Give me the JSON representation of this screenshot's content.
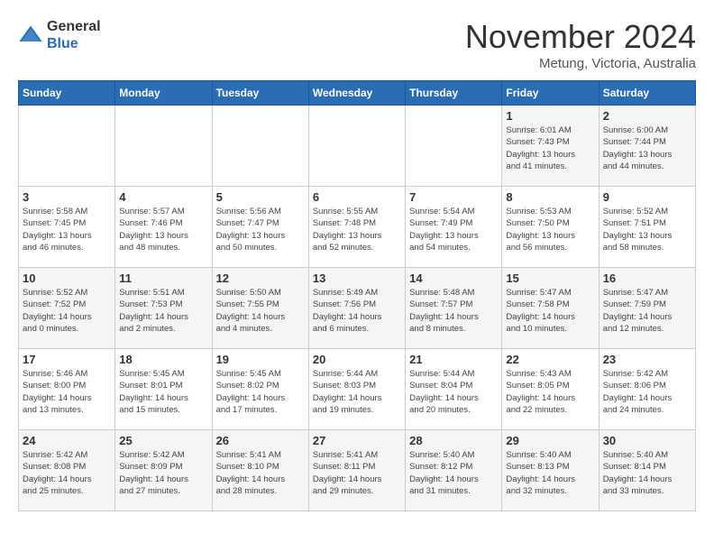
{
  "logo": {
    "general": "General",
    "blue": "Blue"
  },
  "title": "November 2024",
  "location": "Metung, Victoria, Australia",
  "days_of_week": [
    "Sunday",
    "Monday",
    "Tuesday",
    "Wednesday",
    "Thursday",
    "Friday",
    "Saturday"
  ],
  "weeks": [
    [
      {
        "day": "",
        "info": ""
      },
      {
        "day": "",
        "info": ""
      },
      {
        "day": "",
        "info": ""
      },
      {
        "day": "",
        "info": ""
      },
      {
        "day": "",
        "info": ""
      },
      {
        "day": "1",
        "info": "Sunrise: 6:01 AM\nSunset: 7:43 PM\nDaylight: 13 hours\nand 41 minutes."
      },
      {
        "day": "2",
        "info": "Sunrise: 6:00 AM\nSunset: 7:44 PM\nDaylight: 13 hours\nand 44 minutes."
      }
    ],
    [
      {
        "day": "3",
        "info": "Sunrise: 5:58 AM\nSunset: 7:45 PM\nDaylight: 13 hours\nand 46 minutes."
      },
      {
        "day": "4",
        "info": "Sunrise: 5:57 AM\nSunset: 7:46 PM\nDaylight: 13 hours\nand 48 minutes."
      },
      {
        "day": "5",
        "info": "Sunrise: 5:56 AM\nSunset: 7:47 PM\nDaylight: 13 hours\nand 50 minutes."
      },
      {
        "day": "6",
        "info": "Sunrise: 5:55 AM\nSunset: 7:48 PM\nDaylight: 13 hours\nand 52 minutes."
      },
      {
        "day": "7",
        "info": "Sunrise: 5:54 AM\nSunset: 7:49 PM\nDaylight: 13 hours\nand 54 minutes."
      },
      {
        "day": "8",
        "info": "Sunrise: 5:53 AM\nSunset: 7:50 PM\nDaylight: 13 hours\nand 56 minutes."
      },
      {
        "day": "9",
        "info": "Sunrise: 5:52 AM\nSunset: 7:51 PM\nDaylight: 13 hours\nand 58 minutes."
      }
    ],
    [
      {
        "day": "10",
        "info": "Sunrise: 5:52 AM\nSunset: 7:52 PM\nDaylight: 14 hours\nand 0 minutes."
      },
      {
        "day": "11",
        "info": "Sunrise: 5:51 AM\nSunset: 7:53 PM\nDaylight: 14 hours\nand 2 minutes."
      },
      {
        "day": "12",
        "info": "Sunrise: 5:50 AM\nSunset: 7:55 PM\nDaylight: 14 hours\nand 4 minutes."
      },
      {
        "day": "13",
        "info": "Sunrise: 5:49 AM\nSunset: 7:56 PM\nDaylight: 14 hours\nand 6 minutes."
      },
      {
        "day": "14",
        "info": "Sunrise: 5:48 AM\nSunset: 7:57 PM\nDaylight: 14 hours\nand 8 minutes."
      },
      {
        "day": "15",
        "info": "Sunrise: 5:47 AM\nSunset: 7:58 PM\nDaylight: 14 hours\nand 10 minutes."
      },
      {
        "day": "16",
        "info": "Sunrise: 5:47 AM\nSunset: 7:59 PM\nDaylight: 14 hours\nand 12 minutes."
      }
    ],
    [
      {
        "day": "17",
        "info": "Sunrise: 5:46 AM\nSunset: 8:00 PM\nDaylight: 14 hours\nand 13 minutes."
      },
      {
        "day": "18",
        "info": "Sunrise: 5:45 AM\nSunset: 8:01 PM\nDaylight: 14 hours\nand 15 minutes."
      },
      {
        "day": "19",
        "info": "Sunrise: 5:45 AM\nSunset: 8:02 PM\nDaylight: 14 hours\nand 17 minutes."
      },
      {
        "day": "20",
        "info": "Sunrise: 5:44 AM\nSunset: 8:03 PM\nDaylight: 14 hours\nand 19 minutes."
      },
      {
        "day": "21",
        "info": "Sunrise: 5:44 AM\nSunset: 8:04 PM\nDaylight: 14 hours\nand 20 minutes."
      },
      {
        "day": "22",
        "info": "Sunrise: 5:43 AM\nSunset: 8:05 PM\nDaylight: 14 hours\nand 22 minutes."
      },
      {
        "day": "23",
        "info": "Sunrise: 5:42 AM\nSunset: 8:06 PM\nDaylight: 14 hours\nand 24 minutes."
      }
    ],
    [
      {
        "day": "24",
        "info": "Sunrise: 5:42 AM\nSunset: 8:08 PM\nDaylight: 14 hours\nand 25 minutes."
      },
      {
        "day": "25",
        "info": "Sunrise: 5:42 AM\nSunset: 8:09 PM\nDaylight: 14 hours\nand 27 minutes."
      },
      {
        "day": "26",
        "info": "Sunrise: 5:41 AM\nSunset: 8:10 PM\nDaylight: 14 hours\nand 28 minutes."
      },
      {
        "day": "27",
        "info": "Sunrise: 5:41 AM\nSunset: 8:11 PM\nDaylight: 14 hours\nand 29 minutes."
      },
      {
        "day": "28",
        "info": "Sunrise: 5:40 AM\nSunset: 8:12 PM\nDaylight: 14 hours\nand 31 minutes."
      },
      {
        "day": "29",
        "info": "Sunrise: 5:40 AM\nSunset: 8:13 PM\nDaylight: 14 hours\nand 32 minutes."
      },
      {
        "day": "30",
        "info": "Sunrise: 5:40 AM\nSunset: 8:14 PM\nDaylight: 14 hours\nand 33 minutes."
      }
    ]
  ]
}
